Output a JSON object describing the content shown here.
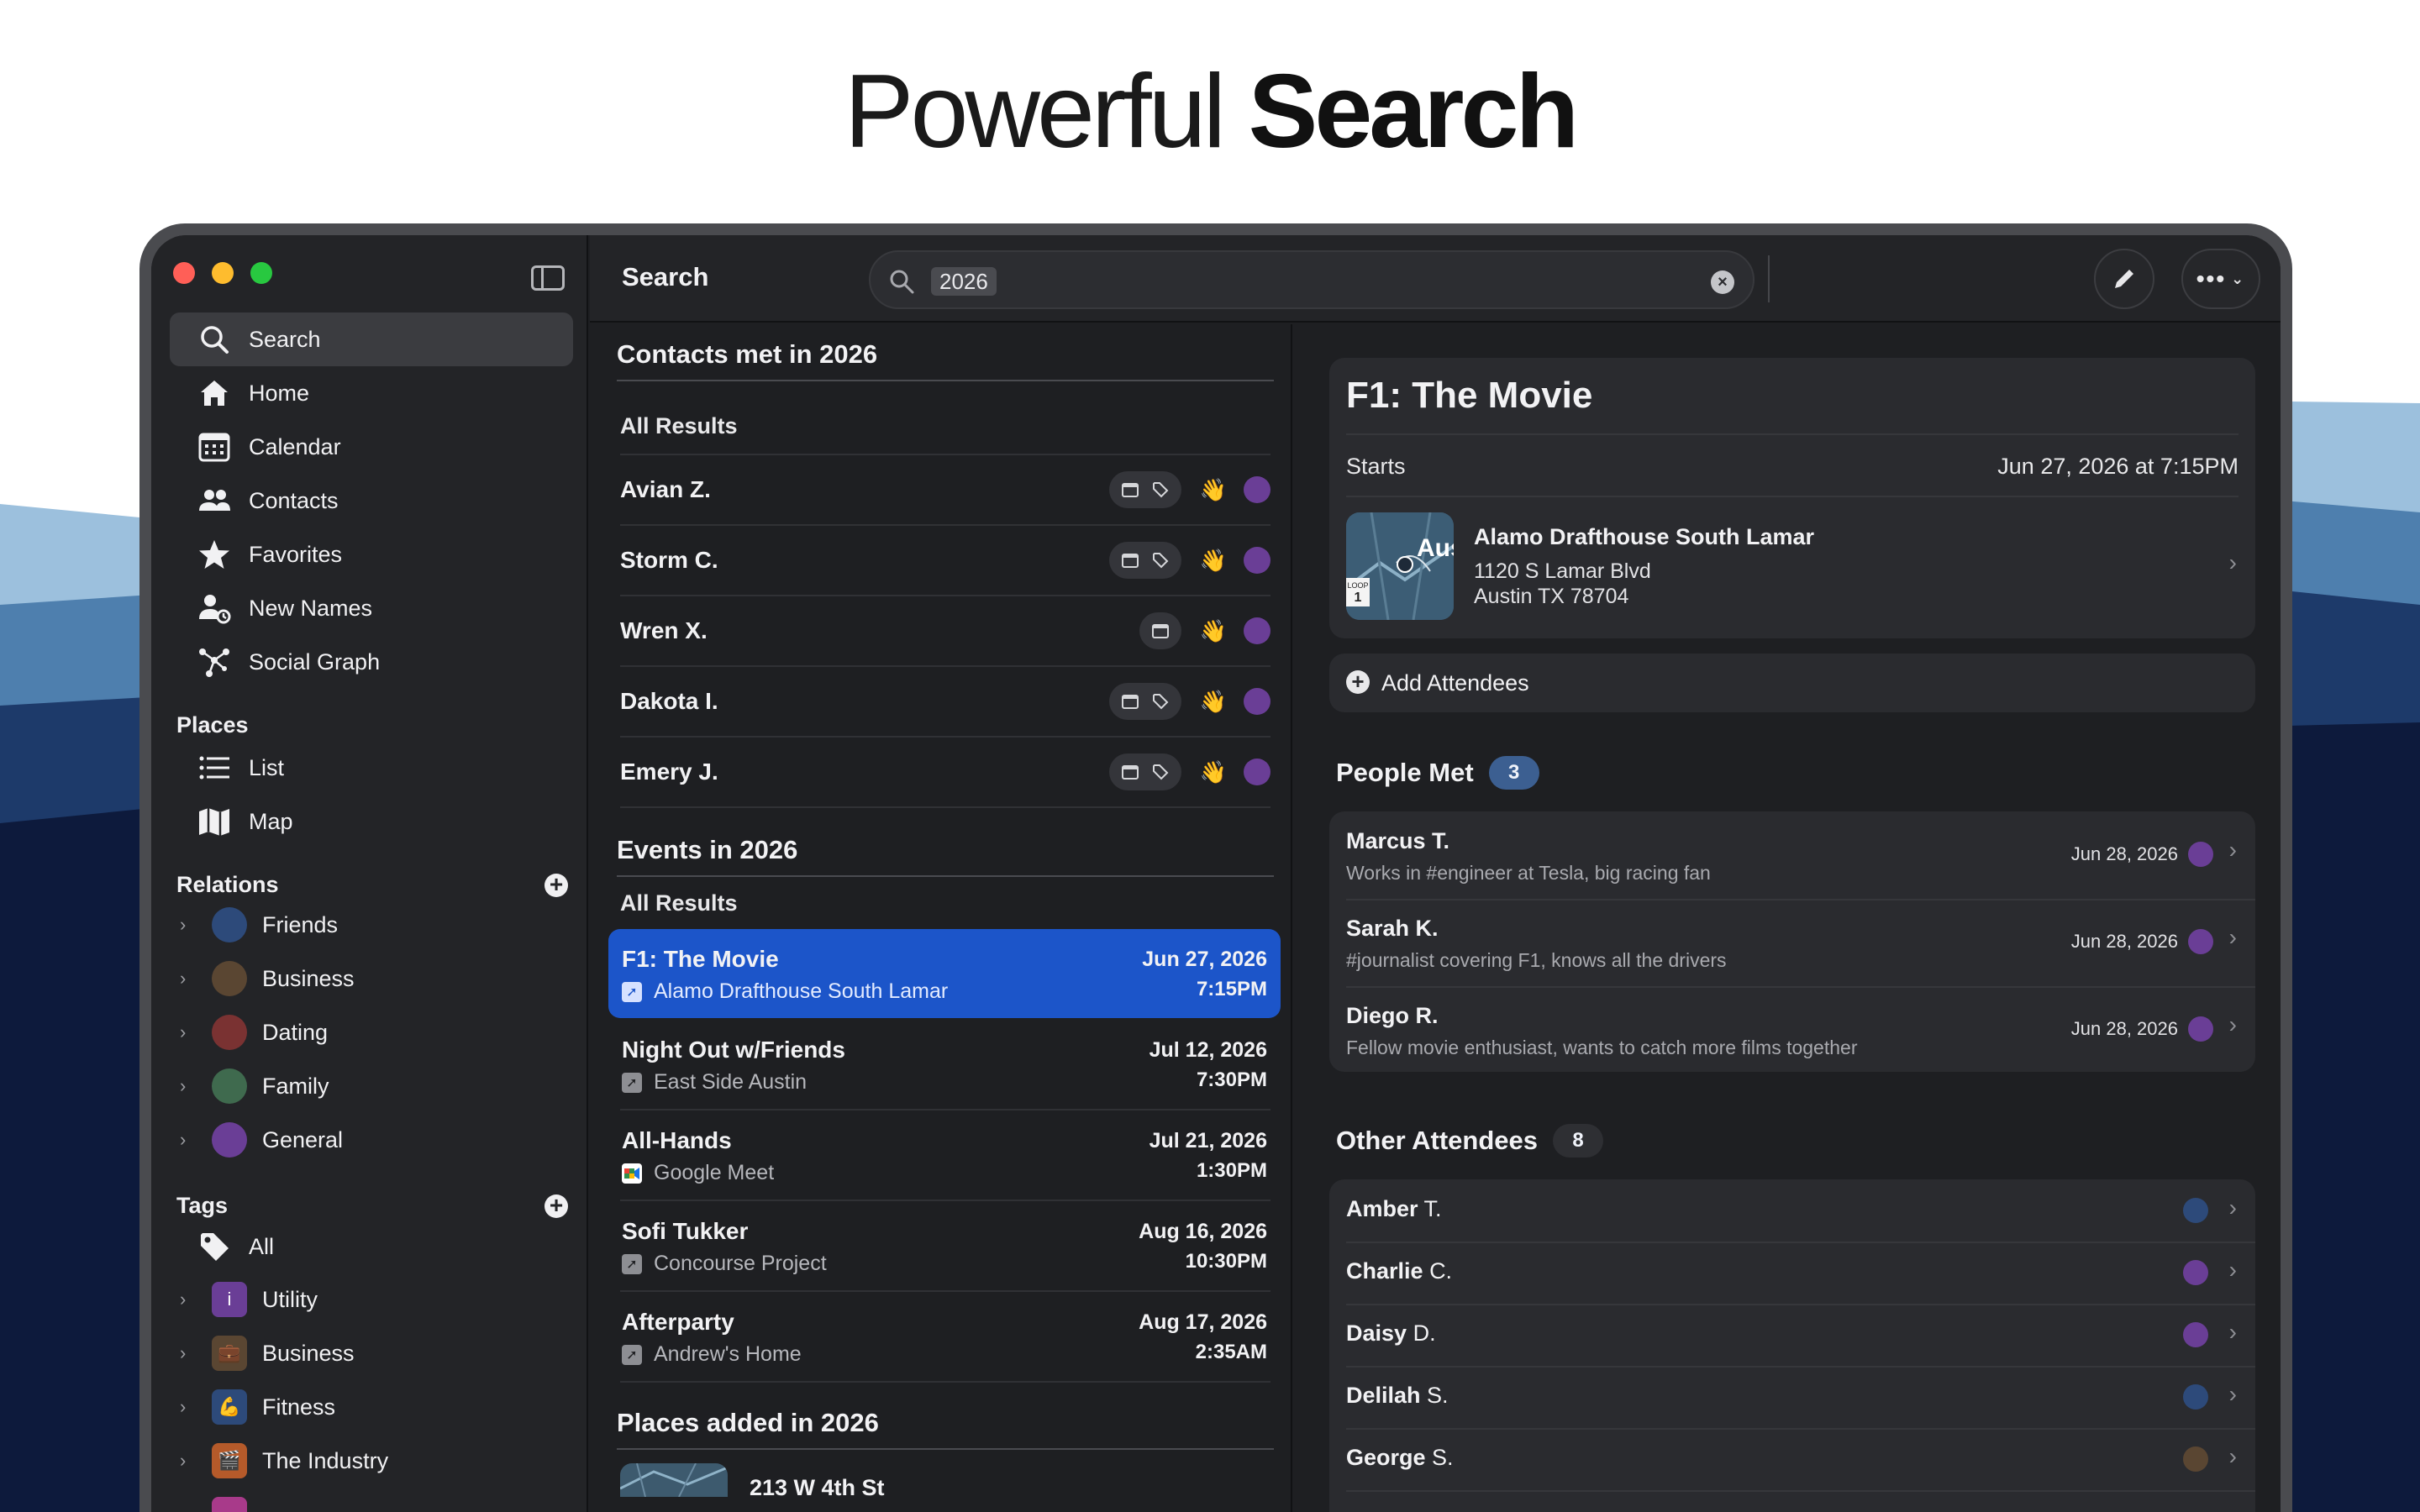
{
  "headline": {
    "light": "Powerful",
    "bold": "Search"
  },
  "sidebar": {
    "nav": [
      {
        "label": "Search",
        "icon": "search-icon",
        "active": true
      },
      {
        "label": "Home",
        "icon": "home-icon"
      },
      {
        "label": "Calendar",
        "icon": "calendar-icon"
      },
      {
        "label": "Contacts",
        "icon": "contacts-icon"
      },
      {
        "label": "Favorites",
        "icon": "star-icon"
      },
      {
        "label": "New Names",
        "icon": "new-names-icon"
      },
      {
        "label": "Social Graph",
        "icon": "social-graph-icon"
      }
    ],
    "places_header": "Places",
    "places": [
      {
        "label": "List",
        "icon": "list-icon"
      },
      {
        "label": "Map",
        "icon": "map-icon"
      }
    ],
    "relations_header": "Relations",
    "relations": [
      {
        "label": "Friends",
        "color": "#2d4a7a"
      },
      {
        "label": "Business",
        "color": "#5a4632"
      },
      {
        "label": "Dating",
        "color": "#7a3232"
      },
      {
        "label": "Family",
        "color": "#3f6a4e"
      },
      {
        "label": "General",
        "color": "#6a3e96"
      }
    ],
    "tags_header": "Tags",
    "tags": [
      {
        "label": "All",
        "icon": "tag-icon"
      },
      {
        "label": "Utility",
        "icon": "info-icon",
        "color": "#6a3e96",
        "glyph": "i"
      },
      {
        "label": "Business",
        "icon": "briefcase-icon",
        "color": "#5a4632",
        "glyph": "💼"
      },
      {
        "label": "Fitness",
        "icon": "flexed-arm-icon",
        "color": "#2d4a7a",
        "glyph": "💪"
      },
      {
        "label": "The Industry",
        "icon": "film-icon",
        "color": "#b55a2a",
        "glyph": "🎬"
      }
    ]
  },
  "topbar": {
    "title": "Search",
    "query": "2026"
  },
  "middle": {
    "contacts_header": "Contacts met in 2026",
    "contacts_all": "All Results",
    "contacts": [
      {
        "name": "Avian Z.",
        "tags": true
      },
      {
        "name": "Storm C.",
        "tags": true
      },
      {
        "name": "Wren X.",
        "tags": false
      },
      {
        "name": "Dakota I.",
        "tags": true
      },
      {
        "name": "Emery J.",
        "tags": true
      }
    ],
    "wave": "👋",
    "events_header": "Events in 2026",
    "events_all": "All Results",
    "events": [
      {
        "title": "F1: The Movie",
        "location": "Alamo Drafthouse South Lamar",
        "date": "Jun 27, 2026",
        "time": "7:15PM",
        "selected": true,
        "loc_icon": "location-arrow-icon"
      },
      {
        "title": "Night Out w/Friends",
        "location": "East Side Austin",
        "date": "Jul 12, 2026",
        "time": "7:30PM",
        "loc_icon": "location-arrow-icon"
      },
      {
        "title": "All-Hands",
        "location": "Google Meet",
        "date": "Jul 21, 2026",
        "time": "1:30PM",
        "loc_icon": "google-meet-icon"
      },
      {
        "title": "Sofi Tukker",
        "location": "Concourse Project",
        "date": "Aug 16, 2026",
        "time": "10:30PM",
        "loc_icon": "location-arrow-icon"
      },
      {
        "title": "Afterparty",
        "location": "Andrew's Home",
        "date": "Aug 17, 2026",
        "time": "2:35AM",
        "loc_icon": "location-arrow-icon"
      }
    ],
    "places_header": "Places added in 2026",
    "places_first": "213 W 4th St"
  },
  "detail": {
    "title": "F1: The Movie",
    "starts_label": "Starts",
    "starts_value": "Jun 27, 2026 at 7:15PM",
    "venue_name": "Alamo Drafthouse South Lamar",
    "venue_addr1": "1120 S Lamar Blvd",
    "venue_addr2": "Austin TX 78704",
    "map_text": "Aus",
    "map_badge": "LOOP 1",
    "add_attendees": "Add Attendees",
    "people_met_title": "People Met",
    "people_met_count": "3",
    "people_met": [
      {
        "name": "Marcus T.",
        "note": "Works in #engineer at Tesla, big racing fan",
        "date": "Jun 28, 2026"
      },
      {
        "name": "Sarah K.",
        "note": "#journalist covering F1, knows all the drivers",
        "date": "Jun 28, 2026"
      },
      {
        "name": "Diego R.",
        "note": "Fellow movie enthusiast, wants to catch more films together",
        "date": "Jun 28, 2026"
      }
    ],
    "other_title": "Other Attendees",
    "other_count": "8",
    "other": [
      {
        "first": "Amber",
        "last": "T.",
        "color": "#2d4a7a"
      },
      {
        "first": "Charlie",
        "last": "C.",
        "color": "#6a3e96"
      },
      {
        "first": "Daisy",
        "last": "D.",
        "color": "#6a3e96"
      },
      {
        "first": "Delilah",
        "last": "S.",
        "color": "#2d4a7a"
      },
      {
        "first": "George",
        "last": "S.",
        "color": "#5a4632"
      }
    ]
  }
}
